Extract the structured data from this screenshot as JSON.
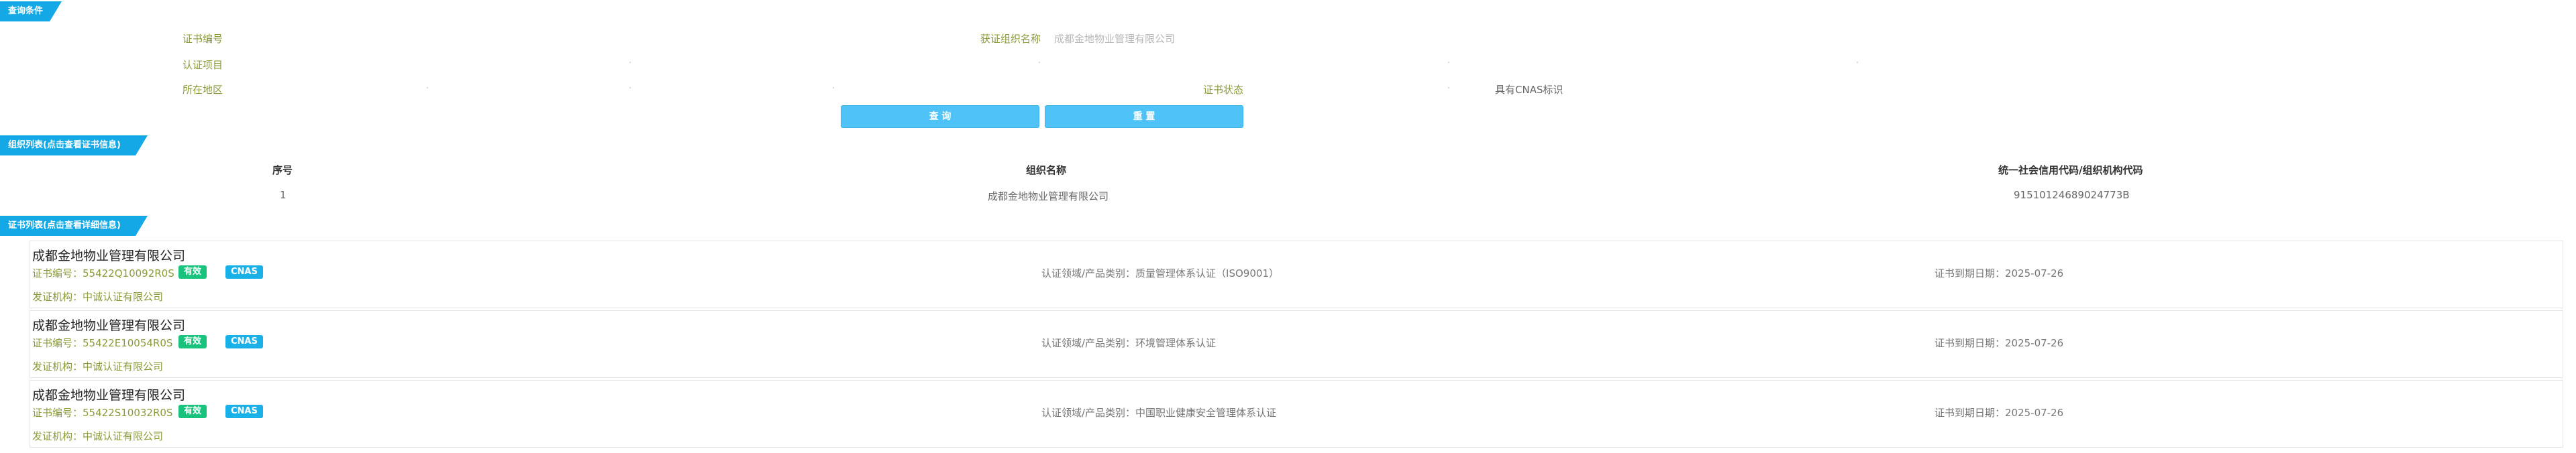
{
  "search_section": {
    "title": "查询条件",
    "cert_no_label": "证书编号",
    "org_name_label": "获证组织名称",
    "org_name_value": "成都金地物业管理有限公司",
    "cert_item_label": "认证项目",
    "region_label": "所在地区",
    "cert_status_label": "证书状态",
    "cnas_label": "具有CNAS标识",
    "search_button": "查 询",
    "reset_button": "重 置"
  },
  "org_section": {
    "title": "组织列表(点击查看证书信息)",
    "columns": [
      "序号",
      "组织名称",
      "统一社会信用代码/组织机构代码"
    ],
    "rows": [
      [
        "1",
        "成都金地物业管理有限公司",
        "91510124689024773B"
      ]
    ]
  },
  "cert_section": {
    "title": "证书列表(点击查看详细信息)",
    "cert_no_prefix": "证书编号：",
    "field_prefix": "认证领域/产品类别：",
    "expiry_prefix": "证书到期日期：",
    "issuer_prefix": "发证机构：",
    "cards": [
      {
        "org": "成都金地物业管理有限公司",
        "cert_no": "证书编号：55422Q10092R0S",
        "status": "有效",
        "cnas": "CNAS",
        "field": "认证领域/产品类别：质量管理体系认证（ISO9001）",
        "expiry": "证书到期日期：2025-07-26",
        "issuer": "发证机构：中诚认证有限公司"
      },
      {
        "org": "成都金地物业管理有限公司",
        "cert_no": "证书编号：55422E10054R0S",
        "status": "有效",
        "cnas": "CNAS",
        "field": "认证领域/产品类别：环境管理体系认证",
        "expiry": "证书到期日期：2025-07-26",
        "issuer": "发证机构：中诚认证有限公司"
      },
      {
        "org": "成都金地物业管理有限公司",
        "cert_no": "证书编号：55422S10032R0S",
        "status": "有效",
        "cnas": "CNAS",
        "field": "认证领域/产品类别：中国职业健康安全管理体系认证",
        "expiry": "证书到期日期：2025-07-26",
        "issuer": "发证机构：中诚认证有限公司"
      }
    ]
  },
  "colors": {
    "accent": "#14a9e6",
    "button": "#4fc3f7",
    "valid_badge": "#19c37d",
    "cnas_badge": "#1ab0e8",
    "label": "#8c9a3c"
  }
}
